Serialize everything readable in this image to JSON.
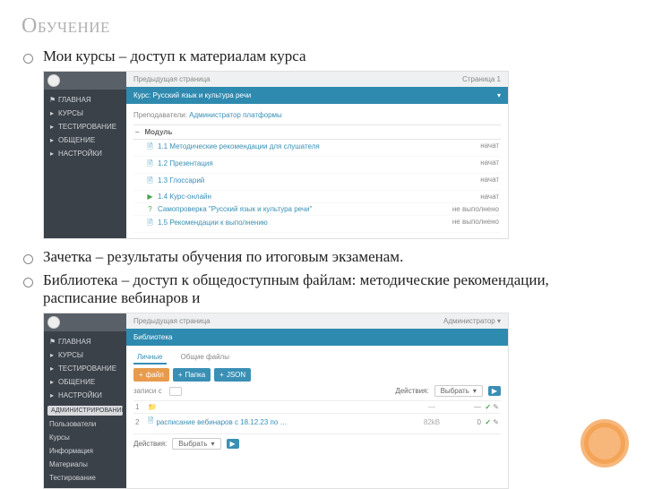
{
  "title": "Обучение",
  "bullets": {
    "b1": "Мои курсы – доступ к материалам курса",
    "b2": "Зачетка – результаты обучения по итоговым экзаменам.",
    "b3": "Библиотека – доступ к общедоступным файлам: методические рекомендации, расписание вебинаров и"
  },
  "s1": {
    "sidebar": {
      "brand": "",
      "items": [
        {
          "glyph": "⚑",
          "label": "ГЛАВНАЯ"
        },
        {
          "glyph": "▸",
          "label": "КУРСЫ"
        },
        {
          "glyph": "▸",
          "label": "ТЕСТИРОВАНИЕ"
        },
        {
          "glyph": "▸",
          "label": "ОБЩЕНИЕ"
        },
        {
          "glyph": "▸",
          "label": "НАСТРОЙКИ"
        }
      ]
    },
    "breadcrumb_left": "Предыдущая страница",
    "breadcrumb_right": "Страница 1",
    "bluebar_left": "Курс: Русский язык и культура речи",
    "bluebar_right": "▾",
    "teacher_label": "Преподаватели:",
    "teacher_name": "Администратор платформы",
    "tbl_col1": "Модуль",
    "tbl_right": "",
    "rows": [
      {
        "ico": "🗎",
        "cls": "ico-doc",
        "name": "1.1 Методические рекомендации для слушателя",
        "status": "начат"
      },
      {
        "ico": "🗎",
        "cls": "ico-doc",
        "name": "1.2 Презентация",
        "status": "начат"
      },
      {
        "ico": "🗎",
        "cls": "ico-doc",
        "name": "1.3 Глоссарий",
        "status": "начат"
      },
      {
        "ico": "▶",
        "cls": "ico-play",
        "name": "1.4 Курс-онлайн",
        "status": "начат"
      },
      {
        "ico": "?",
        "cls": "ico-q",
        "name": "Самопроверка \"Русский язык и культура речи\"",
        "status": "не выполнено"
      },
      {
        "ico": "🗎",
        "cls": "ico-doc",
        "name": "1.5 Рекомендации к выполнению",
        "status": "не выполнено"
      }
    ]
  },
  "s2": {
    "sidebar": {
      "items": [
        {
          "glyph": "⚑",
          "label": "ГЛАВНАЯ"
        },
        {
          "glyph": "▸",
          "label": "КУРСЫ"
        },
        {
          "glyph": "▸",
          "label": "ТЕСТИРОВАНИЕ"
        },
        {
          "glyph": "▸",
          "label": "ОБЩЕНИЕ"
        },
        {
          "glyph": "▸",
          "label": "НАСТРОЙКИ"
        }
      ],
      "admin_badge": "АДМИНИСТРИРОВАНИЕ",
      "admin_items": [
        {
          "label": "Пользователи"
        },
        {
          "label": "Курсы"
        },
        {
          "label": "Информация"
        },
        {
          "label": "Материалы"
        },
        {
          "label": "Тестирование"
        }
      ]
    },
    "breadcrumb_left": "Предыдущая страница",
    "breadcrumb_right": "Администратор ▾",
    "bluebar_left": "Библиотека",
    "tab_active": "Личные",
    "tab_other": "Общие файлы",
    "btn1": "файл",
    "btn2": "Папка",
    "btn3": "JSON",
    "filter_label": "Действия:",
    "filter_sel": "Выбрать",
    "filter_go": "▶",
    "rows": [
      {
        "n": "1",
        "name": "",
        "size": "—",
        "dl": "—"
      },
      {
        "n": "2",
        "name": "расписание вебинаров с 18.12.23 по …",
        "size": "82kB",
        "dl": "0"
      }
    ],
    "foot_label": "Действия:",
    "foot_sel": "Выбрать"
  }
}
